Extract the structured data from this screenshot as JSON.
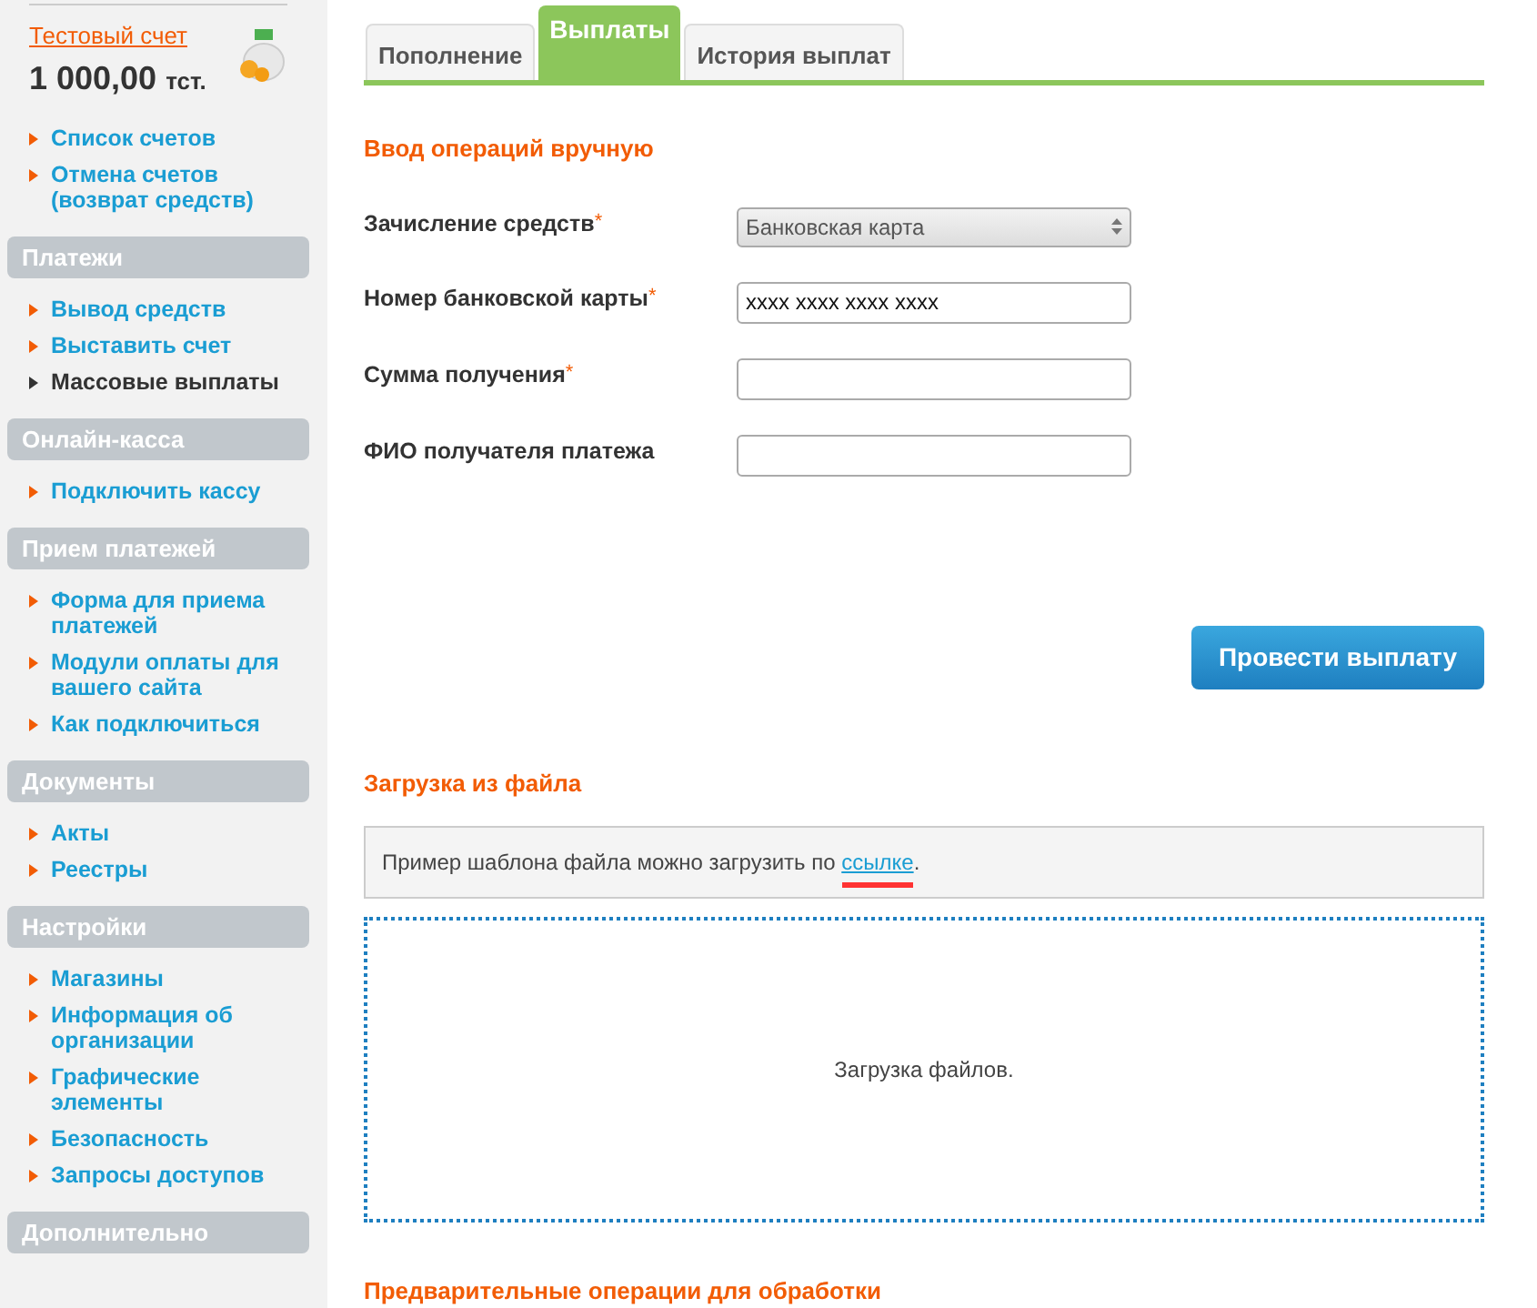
{
  "account": {
    "title": "Тестовый счет",
    "balance": "1 000,00",
    "currency": "тст."
  },
  "sidebar": [
    {
      "kind": "links",
      "items": [
        {
          "label": "Список счетов",
          "selected": false
        },
        {
          "label": "Отмена счетов (возврат средств)",
          "selected": false
        }
      ]
    },
    {
      "kind": "header",
      "label": "Платежи"
    },
    {
      "kind": "links",
      "items": [
        {
          "label": "Вывод средств",
          "selected": false
        },
        {
          "label": "Выставить счет",
          "selected": false
        },
        {
          "label": "Массовые выплаты",
          "selected": true
        }
      ]
    },
    {
      "kind": "header",
      "label": "Онлайн-касса"
    },
    {
      "kind": "links",
      "items": [
        {
          "label": "Подключить кассу",
          "selected": false
        }
      ]
    },
    {
      "kind": "header",
      "label": "Прием платежей"
    },
    {
      "kind": "links",
      "items": [
        {
          "label": "Форма для приема платежей",
          "selected": false
        },
        {
          "label": "Модули оплаты для вашего сайта",
          "selected": false
        },
        {
          "label": "Как подключиться",
          "selected": false
        }
      ]
    },
    {
      "kind": "header",
      "label": "Документы"
    },
    {
      "kind": "links",
      "items": [
        {
          "label": "Акты",
          "selected": false
        },
        {
          "label": "Реестры",
          "selected": false
        }
      ]
    },
    {
      "kind": "header",
      "label": "Настройки"
    },
    {
      "kind": "links",
      "items": [
        {
          "label": "Магазины",
          "selected": false
        },
        {
          "label": "Информация об организации",
          "selected": false
        },
        {
          "label": "Графические элементы",
          "selected": false
        },
        {
          "label": "Безопасность",
          "selected": false
        },
        {
          "label": "Запросы доступов",
          "selected": false
        }
      ]
    },
    {
      "kind": "header",
      "label": "Дополнительно"
    }
  ],
  "tabs": [
    {
      "label": "Пополнение",
      "selected": false
    },
    {
      "label": "Выплаты",
      "selected": true
    },
    {
      "label": "История выплат",
      "selected": false
    }
  ],
  "manual": {
    "heading": "Ввод операций вручную",
    "fields": [
      {
        "kind": "select",
        "label": "Зачисление средств",
        "required_mark": "*",
        "value": "Банковская карта"
      },
      {
        "kind": "text",
        "label": "Номер банковской карты",
        "required_mark": "*",
        "value": "xxxx xxxx xxxx xxxx"
      },
      {
        "kind": "text",
        "label": "Сумма получения",
        "required_mark": "*"
      },
      {
        "kind": "text",
        "label": "ФИО получателя платежа"
      }
    ],
    "submit": "Провести выплату"
  },
  "upload": {
    "heading": "Загрузка из файла",
    "note": "Пример шаблона файла можно загрузить по",
    "link": "ссылке",
    "link_highlighted": true,
    "note_end": ".",
    "dropzone": "Загрузка файлов."
  },
  "next_heading": "Предварительные операции для обработки"
}
